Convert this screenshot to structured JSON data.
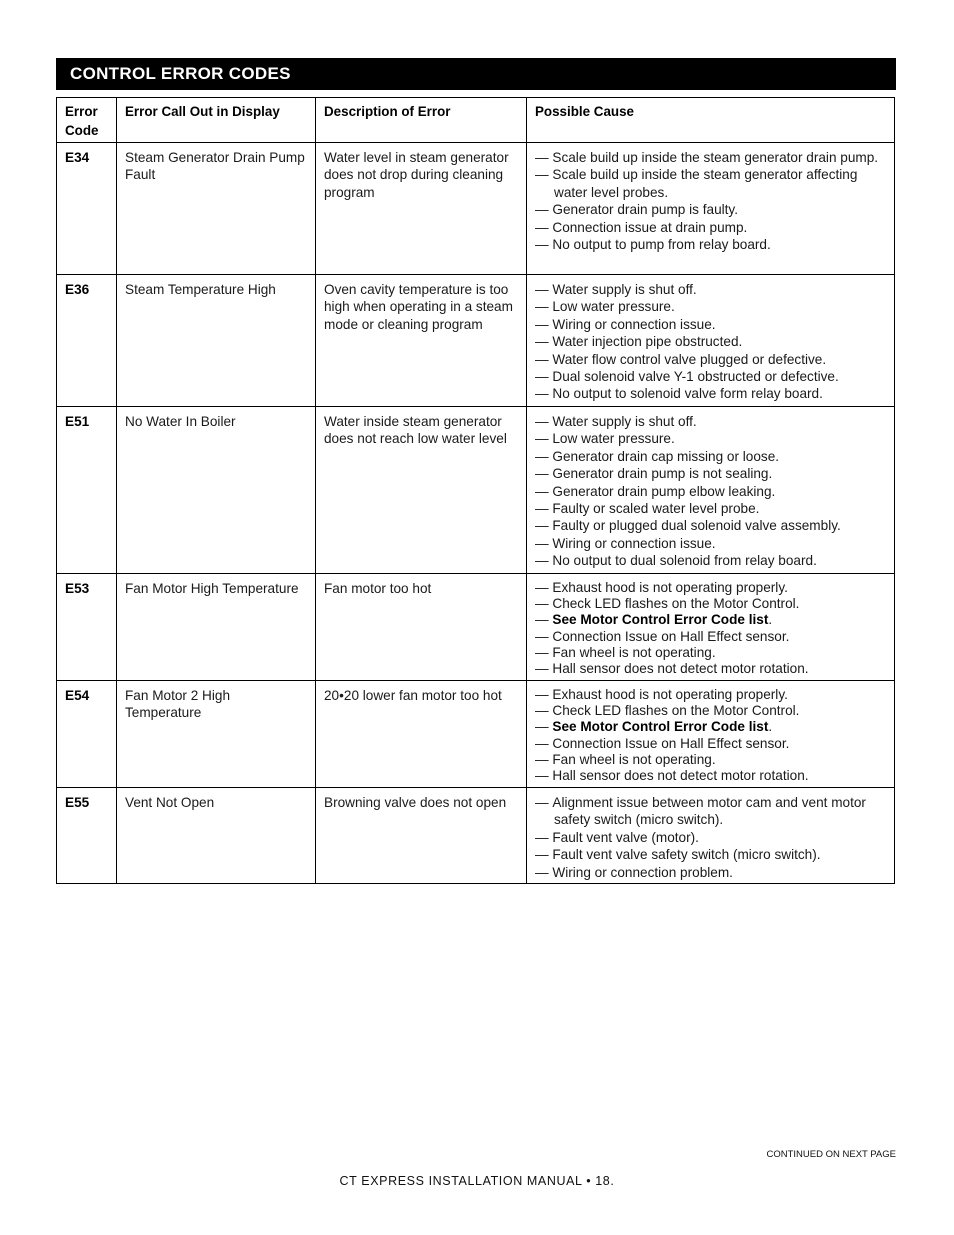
{
  "section_title": "CONTROL ERROR CODES",
  "table": {
    "headers": {
      "code": "Error Code",
      "callout": "Error Call Out in Display",
      "description": "Description of Error",
      "cause": "Possible Cause"
    },
    "rows": [
      {
        "code": "E34",
        "callout": "Steam Generator Drain Pump Fault",
        "description": "Water level in steam generator does not drop during cleaning program",
        "causes": [
          "Scale build up inside the steam generator drain pump.",
          "Scale build up inside the steam generator affecting water level probes.",
          "Generator drain pump is faulty.",
          "Connection issue at drain pump.",
          "No output to pump from relay board."
        ]
      },
      {
        "code": "E36",
        "callout": "Steam Temperature High",
        "description": "Oven cavity temperature is too high when operating in a steam mode or cleaning program",
        "causes": [
          "Water supply is shut off.",
          "Low water pressure.",
          "Wiring or connection issue.",
          "Water injection pipe obstructed.",
          "Water flow control valve plugged or defective.",
          "Dual solenoid valve Y-1 obstructed or defective.",
          "No output to solenoid valve form relay board."
        ]
      },
      {
        "code": "E51",
        "callout": "No Water In Boiler",
        "description": "Water inside steam generator does not reach low water level",
        "causes": [
          "Water supply is shut off.",
          "Low water pressure.",
          "Generator drain cap missing or loose.",
          "Generator drain pump is not sealing.",
          "Generator drain pump elbow leaking.",
          "Faulty or scaled water level probe.",
          "Faulty or plugged dual solenoid valve assembly.",
          "Wiring or connection issue.",
          "No output to dual solenoid from relay board."
        ]
      },
      {
        "code": "E53",
        "callout": "Fan Motor High Temperature",
        "description": "Fan motor too hot",
        "causes": [
          "Exhaust hood is not operating properly.",
          "Check LED flashes on the Motor Control.",
          {
            "bold": "See Motor Control Error Code list",
            "rest": "."
          },
          "Connection Issue on Hall Effect sensor.",
          "Fan wheel is not operating.",
          "Hall sensor does not detect motor rotation."
        ]
      },
      {
        "code": "E54",
        "callout": "Fan Motor 2 High Temperature",
        "description": "20•20 lower fan motor too hot",
        "causes": [
          "Exhaust hood is not operating properly.",
          "Check LED flashes on the Motor Control.",
          {
            "bold": "See Motor Control Error Code list",
            "rest": "."
          },
          "Connection Issue on Hall Effect sensor.",
          "Fan wheel is not operating.",
          "Hall sensor does not detect motor rotation."
        ]
      },
      {
        "code": "E55",
        "callout": "Vent Not Open",
        "description": "Browning valve does not open",
        "causes": [
          "Alignment issue between motor cam and vent motor safety switch (micro switch).",
          "Fault vent valve (motor).",
          "Fault vent valve safety switch (micro switch).",
          "Wiring or connection problem."
        ]
      }
    ]
  },
  "continued_note": "CONTINUED ON NEXT PAGE",
  "footer": "CT EXPRESS INSTALLATION MANUAL • 18."
}
